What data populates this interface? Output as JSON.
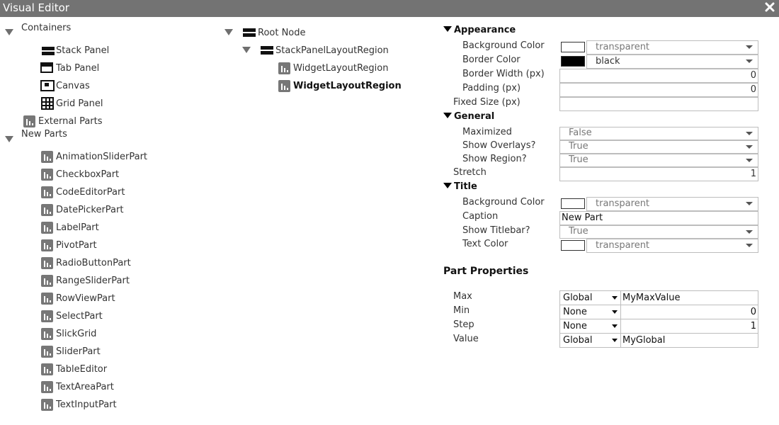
{
  "window": {
    "title": "Visual Editor"
  },
  "toolbox": {
    "containers_label": "Containers",
    "containers": [
      {
        "label": "Stack Panel",
        "icon": "stack-panel-icon"
      },
      {
        "label": "Tab Panel",
        "icon": "tab-panel-icon"
      },
      {
        "label": "Canvas",
        "icon": "canvas-icon"
      },
      {
        "label": "Grid Panel",
        "icon": "grid-panel-icon"
      }
    ],
    "external_parts_label": "External Parts",
    "new_parts_label": "New Parts",
    "new_parts": [
      "AnimationSliderPart",
      "CheckboxPart",
      "CodeEditorPart",
      "DatePickerPart",
      "LabelPart",
      "PivotPart",
      "RadioButtonPart",
      "RangeSliderPart",
      "RowViewPart",
      "SelectPart",
      "SlickGrid",
      "SliderPart",
      "TableEditor",
      "TextAreaPart",
      "TextInputPart"
    ]
  },
  "tree": {
    "root": "Root Node",
    "region": "StackPanelLayoutRegion",
    "widget1": "WidgetLayoutRegion",
    "widget2": "WidgetLayoutRegion"
  },
  "properties": {
    "appearance": {
      "title": "Appearance",
      "background_color": {
        "label": "Background Color",
        "value": "transparent",
        "swatch": "#ffffff"
      },
      "border_color": {
        "label": "Border Color",
        "value": "black",
        "swatch": "#000000"
      },
      "border_width": {
        "label": "Border Width (px)",
        "value": "0"
      },
      "padding": {
        "label": "Padding (px)",
        "value": "0"
      },
      "fixed_size": {
        "label": "Fixed Size (px)",
        "value": ""
      }
    },
    "general": {
      "title": "General",
      "maximized": {
        "label": "Maximized",
        "value": "False"
      },
      "show_overlays": {
        "label": "Show Overlays?",
        "value": "True"
      },
      "show_region": {
        "label": "Show Region?",
        "value": "True"
      },
      "stretch": {
        "label": "Stretch",
        "value": "1"
      }
    },
    "title_section": {
      "title": "Title",
      "background_color": {
        "label": "Background Color",
        "value": "transparent",
        "swatch": "#ffffff"
      },
      "caption": {
        "label": "Caption",
        "value": "New Part"
      },
      "show_titlebar": {
        "label": "Show Titlebar?",
        "value": "True"
      },
      "text_color": {
        "label": "Text Color",
        "value": "transparent",
        "swatch": "#ffffff"
      }
    }
  },
  "part_properties": {
    "title": "Part Properties",
    "max": {
      "label": "Max",
      "scope": "Global",
      "value": "MyMaxValue"
    },
    "min": {
      "label": "Min",
      "scope": "None",
      "value": "0"
    },
    "step": {
      "label": "Step",
      "scope": "None",
      "value": "1"
    },
    "value": {
      "label": "Value",
      "scope": "Global",
      "value": "MyGlobal"
    }
  },
  "colors": {
    "titlebar": "#737373",
    "icon_gray": "#777777"
  }
}
